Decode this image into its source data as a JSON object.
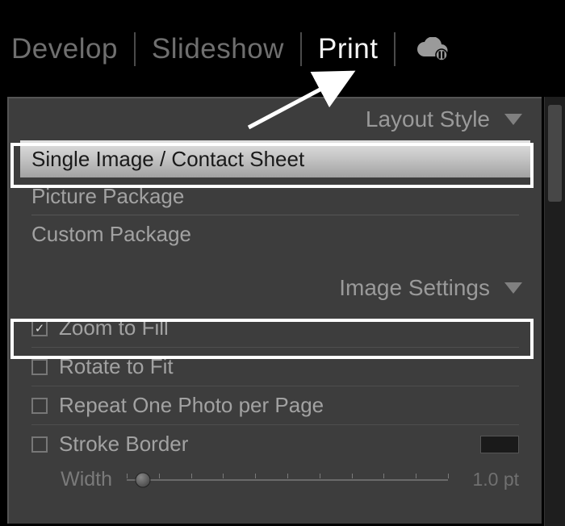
{
  "nav": {
    "items": [
      {
        "label": "Develop",
        "active": false
      },
      {
        "label": "Slideshow",
        "active": false
      },
      {
        "label": "Print",
        "active": true
      }
    ]
  },
  "panels": {
    "layout_style": {
      "title": "Layout Style",
      "options": [
        {
          "label": "Single Image / Contact Sheet",
          "selected": true
        },
        {
          "label": "Picture Package",
          "selected": false
        },
        {
          "label": "Custom Package",
          "selected": false
        }
      ]
    },
    "image_settings": {
      "title": "Image Settings",
      "items": [
        {
          "label": "Zoom to Fill",
          "checked": true
        },
        {
          "label": "Rotate to Fit",
          "checked": false
        },
        {
          "label": "Repeat One Photo per Page",
          "checked": false
        },
        {
          "label": "Stroke Border",
          "checked": false
        }
      ],
      "stroke_width": {
        "label": "Width",
        "value": "1.0 pt"
      }
    }
  }
}
